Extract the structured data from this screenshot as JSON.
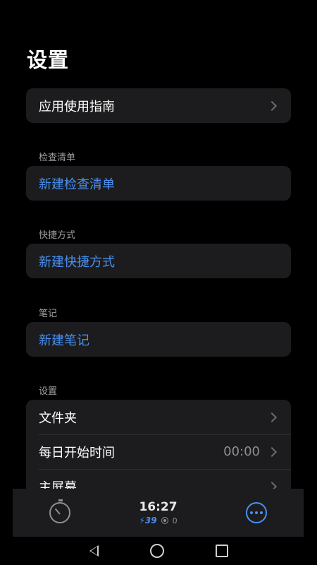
{
  "page": {
    "title": "设置"
  },
  "guide": {
    "label": "应用使用指南"
  },
  "checklist": {
    "header": "检查清单",
    "action": "新建检查清单"
  },
  "shortcut": {
    "header": "快捷方式",
    "action": "新建快捷方式"
  },
  "notes": {
    "header": "笔记",
    "action": "新建笔记"
  },
  "settings": {
    "header": "设置",
    "items": [
      {
        "label": "文件夹",
        "value": ""
      },
      {
        "label": "每日开始时间",
        "value": "00:00"
      },
      {
        "label": "主屏幕",
        "value": ""
      }
    ]
  },
  "toolbar": {
    "time": "16:27",
    "battery": "⚡39",
    "count": "0"
  },
  "colors": {
    "accent": "#4a90f0",
    "card": "#1c1c1e",
    "background": "#000000"
  },
  "icons": [
    "chevron-right-icon",
    "timer-icon",
    "target-icon",
    "more-icon",
    "nav-back-icon",
    "nav-home-icon",
    "nav-recent-icon"
  ]
}
